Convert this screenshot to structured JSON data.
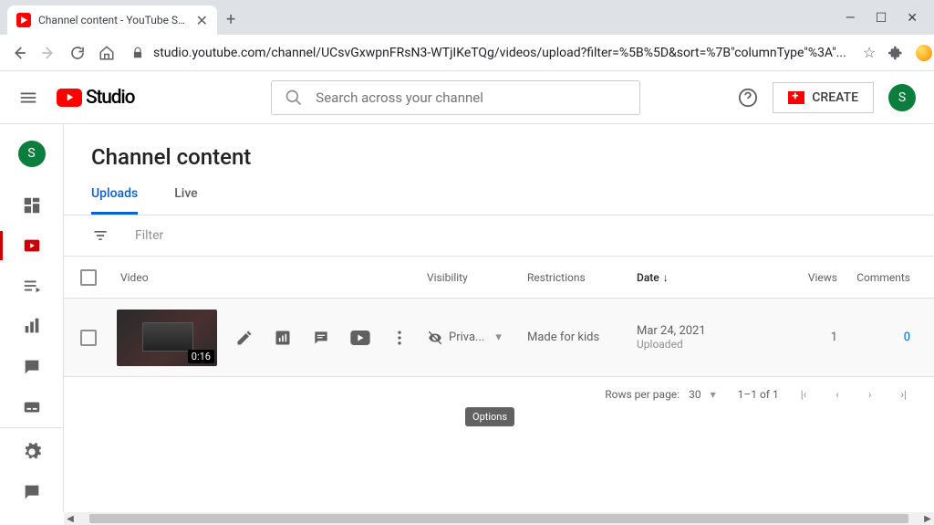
{
  "browser": {
    "tab_title": "Channel content - YouTube Studio",
    "url": "studio.youtube.com/channel/UCsvGxwpnFRsN3-WTjIKeTQg/videos/upload?filter=%5B%5D&sort=%7B\"columnType\"%3A\"..."
  },
  "header": {
    "logo_text": "Studio",
    "search_placeholder": "Search across your channel",
    "create_label": "CREATE",
    "avatar_initial": "S"
  },
  "sidebar": {
    "avatar_initial": "S"
  },
  "page": {
    "title": "Channel content",
    "tabs": {
      "uploads": "Uploads",
      "live": "Live"
    },
    "filter": "Filter"
  },
  "table": {
    "headers": {
      "video": "Video",
      "visibility": "Visibility",
      "restrictions": "Restrictions",
      "date": "Date",
      "views": "Views",
      "comments": "Comments"
    },
    "rows": [
      {
        "duration": "0:16",
        "visibility": "Priva...",
        "restrictions": "Made for kids",
        "date": "Mar 24, 2021",
        "date_sub": "Uploaded",
        "views": "1",
        "comments": "0"
      }
    ]
  },
  "tooltip": "Options",
  "pager": {
    "rpp_label": "Rows per page:",
    "rpp_value": "30",
    "range": "1–1 of 1"
  }
}
